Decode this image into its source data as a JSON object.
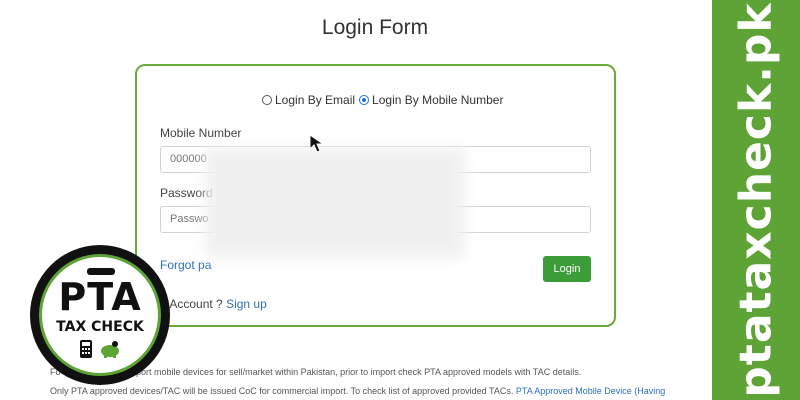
{
  "page": {
    "title": "Login Form"
  },
  "form": {
    "login_by_email_label": "Login By Email",
    "login_by_mobile_label": "Login By Mobile Number",
    "selected_mode": "mobile",
    "mobile_label": "Mobile Number",
    "mobile_value": "000000",
    "password_label": "Password",
    "password_placeholder": "Passwo",
    "forgot_label": "Forgot pa",
    "login_button": "Login",
    "no_account_text": "o Account ?",
    "signup_link": "Sign up"
  },
  "footer": {
    "line1": "Fo                    tities wishing to import mobile devices for sell/market within Pakistan, prior to import check PTA approved models with TAC details.",
    "line2_text": "Only PTA approved devices/TAC will be issued CoC for commercial import. To check list of approved provided TACs.",
    "line2_link": "PTA Approved Mobile Device (Having"
  },
  "brand": {
    "sidebar_text": "ptataxcheck.pk",
    "logo_title": "PTA",
    "logo_subtitle": "TAX CHECK",
    "accent_color": "#5da336",
    "button_color": "#3d9c3a",
    "link_color": "#2f6fb8"
  }
}
